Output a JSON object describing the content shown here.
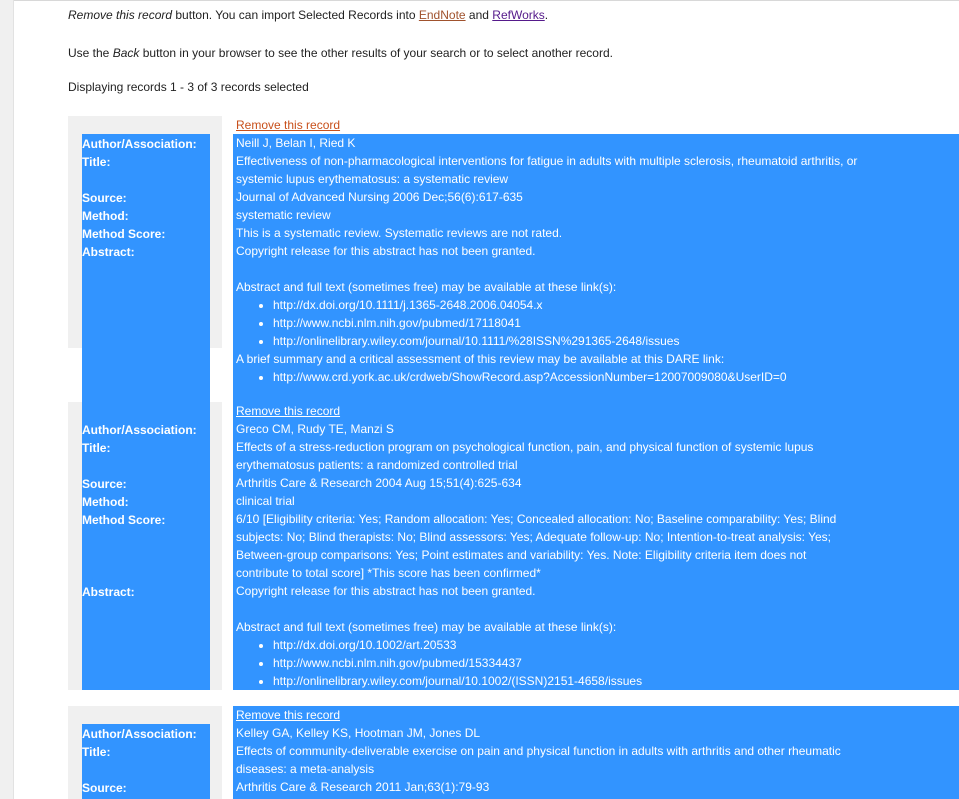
{
  "intro": {
    "line1_prefix_italic": "Remove this record",
    "line1_mid": " button. You can import Selected Records into ",
    "endnote_link": "EndNote",
    "and_text": " and ",
    "refworks_link": "RefWorks",
    "line1_end": ".",
    "line2_prefix": "Use the ",
    "line2_back_italic": "Back",
    "line2_rest": " button in your browser to see the other results of your search or to select another record.",
    "line3": "Displaying records 1 - 3 of 3 records selected"
  },
  "labels": {
    "author": "Author/Association:",
    "title": "Title:",
    "source": "Source:",
    "method": "Method:",
    "method_score": "Method Score:",
    "abstract": "Abstract:"
  },
  "records": [
    {
      "remove_label": "Remove this record",
      "authors": "Neill J, Belan I, Ried K",
      "title_line1": "Effectiveness of non-pharmacological interventions for fatigue in adults with multiple sclerosis, rheumatoid arthritis, or",
      "title_line2": "systemic lupus erythematosus: a systematic review",
      "source": "Journal of Advanced Nursing 2006 Dec;56(6):617-635",
      "method": "systematic review",
      "method_score": "This is a systematic review. Systematic reviews are not rated.",
      "abstract": "Copyright release for this abstract has not been granted.",
      "links_intro": "Abstract and full text (sometimes free) may be available at these link(s):",
      "links": [
        "http://dx.doi.org/10.1111/j.1365-2648.2006.04054.x",
        "http://www.ncbi.nlm.nih.gov/pubmed/17118041",
        "http://onlinelibrary.wiley.com/journal/10.1111/%28ISSN%291365-2648/issues"
      ],
      "dare_intro": "A brief summary and a critical assessment of this review may be available at this DARE link:",
      "dare_link": "http://www.crd.york.ac.uk/crdweb/ShowRecord.asp?AccessionNumber=12007009080&UserID=0"
    },
    {
      "remove_label": "Remove this record",
      "authors": "Greco CM, Rudy TE, Manzi S",
      "title_line1": "Effects of a stress-reduction program on psychological function, pain, and physical function of systemic lupus",
      "title_line2": "erythematosus patients: a randomized controlled trial",
      "source": "Arthritis Care & Research 2004 Aug 15;51(4):625-634",
      "method": "clinical trial",
      "method_score_lines": [
        "6/10 [Eligibility criteria: Yes; Random allocation: Yes; Concealed allocation: No; Baseline comparability: Yes; Blind",
        "subjects: No; Blind therapists: No; Blind assessors: Yes; Adequate follow-up: No; Intention-to-treat analysis: Yes;",
        "Between-group comparisons: Yes; Point estimates and variability: Yes. Note: Eligibility criteria item does not",
        "contribute to total score] *This score has been confirmed*"
      ],
      "abstract": "Copyright release for this abstract has not been granted.",
      "links_intro": "Abstract and full text (sometimes free) may be available at these link(s):",
      "links": [
        "http://dx.doi.org/10.1002/art.20533",
        "http://www.ncbi.nlm.nih.gov/pubmed/15334437",
        "http://onlinelibrary.wiley.com/journal/10.1002/(ISSN)2151-4658/issues"
      ]
    },
    {
      "remove_label": "Remove this record",
      "authors": "Kelley GA, Kelley KS, Hootman JM, Jones DL",
      "title_line1": "Effects of community-deliverable exercise on pain and physical function in adults with arthritis and other rheumatic",
      "title_line2": "diseases: a meta-analysis",
      "source": "Arthritis Care & Research 2011 Jan;63(1):79-93"
    }
  ]
}
